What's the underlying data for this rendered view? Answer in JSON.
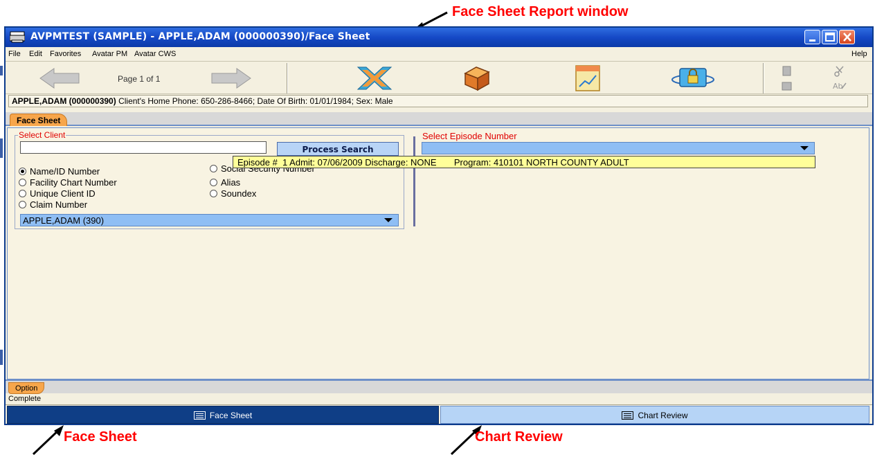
{
  "annotations": {
    "window_label": "Face Sheet Report window",
    "face_sheet_label": "Face Sheet",
    "chart_review_label": "Chart Review"
  },
  "window": {
    "title": "AVPMTEST (SAMPLE) - APPLE,ADAM (000000390)/Face Sheet"
  },
  "menu": {
    "file": "File",
    "edit": "Edit",
    "favorites": "Favorites",
    "avatar_pm": "Avatar PM",
    "avatar_cws": "Avatar CWS",
    "help": "Help"
  },
  "toolbar": {
    "page_label": "Page 1 of 1"
  },
  "client_info": {
    "name_id": "APPLE,ADAM (000000390)",
    "details": " Client's Home Phone: 650-286-8466; Date Of Birth: 01/01/1984; Sex: Male"
  },
  "tabs": {
    "face_sheet": "Face Sheet",
    "option": "Option"
  },
  "select_client": {
    "group_label": "Select Client",
    "search_value": "",
    "process_button": "Process Search",
    "radios": [
      {
        "label": "Name/ID Number",
        "checked": true
      },
      {
        "label": "Facility Chart Number",
        "checked": false
      },
      {
        "label": "Unique Client ID",
        "checked": false
      },
      {
        "label": "Claim Number",
        "checked": false
      },
      {
        "label": "Social Security Number",
        "checked": false
      },
      {
        "label": "Alias",
        "checked": false
      },
      {
        "label": "Soundex",
        "checked": false
      }
    ],
    "selected_client": "APPLE,ADAM (390)"
  },
  "episode": {
    "label": "Select Episode Number",
    "tooltip": "Episode #  1 Admit: 07/06/2009 Discharge: NONE       Program: 410101 NORTH COUNTY ADULT"
  },
  "status": {
    "text": "Complete"
  },
  "taskbar": {
    "face_sheet": "Face Sheet",
    "chart_review": "Chart Review"
  },
  "colors": {
    "title_blue": "#1549c6",
    "tab_orange": "#f7a64b",
    "label_red": "#e00000",
    "select_blue": "#8fbef4",
    "tooltip_yellow": "#ffff99",
    "annotation_red": "#ff0000"
  }
}
